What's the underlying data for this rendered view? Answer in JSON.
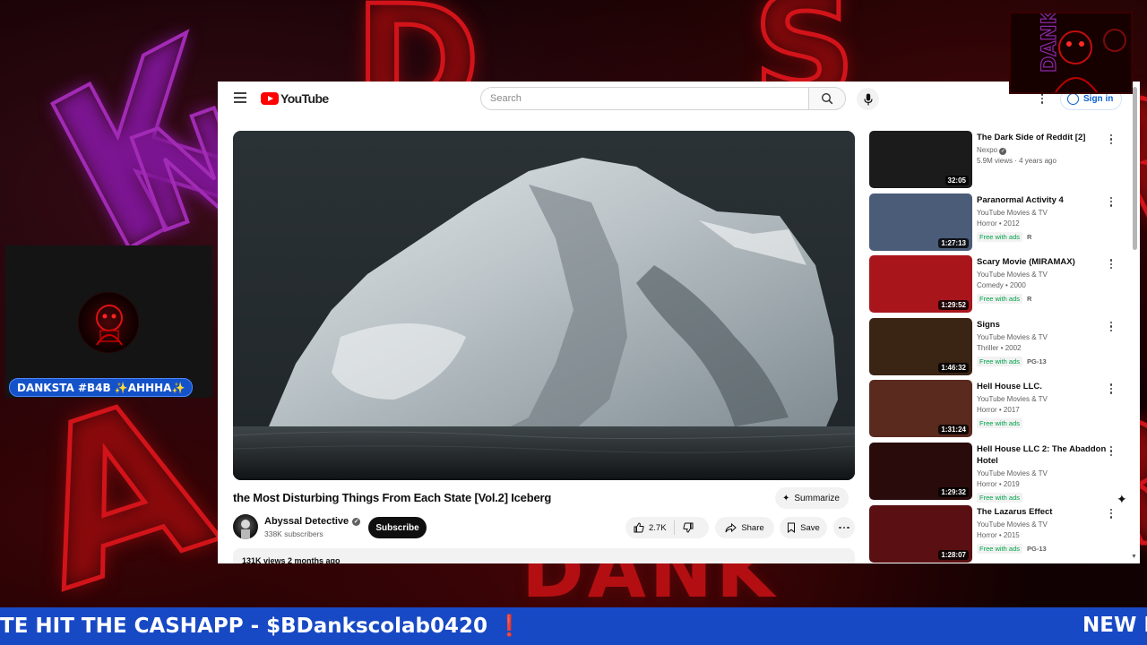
{
  "youtube": {
    "logo_text": "YouTube",
    "search_placeholder": "Search",
    "signin_label": "Sign in",
    "video": {
      "title": "the Most Disturbing Things From Each State [Vol.2] Iceberg",
      "summarize_label": "Summarize",
      "channel_name": "Abyssal Detective",
      "subscribers": "338K subscribers",
      "subscribe_label": "Subscribe",
      "likes": "2.7K",
      "share_label": "Share",
      "save_label": "Save",
      "views_date": "131K views  2 months ago"
    },
    "recommendations": [
      {
        "title": "The Dark Side of Reddit [2]",
        "channel": "Nexpo",
        "verified": true,
        "meta": "5.9M views · 4 years ago",
        "duration": "32:05",
        "free": "",
        "rating": "",
        "thumb_color": "#1b1b1b"
      },
      {
        "title": "Paranormal Activity 4",
        "channel": "YouTube Movies & TV",
        "verified": false,
        "meta": "Horror • 2012",
        "duration": "1:27:13",
        "free": "Free with ads",
        "rating": "R",
        "thumb_color": "#4a5c78"
      },
      {
        "title": "Scary Movie (MIRAMAX)",
        "channel": "YouTube Movies & TV",
        "verified": false,
        "meta": "Comedy • 2000",
        "duration": "1:29:52",
        "free": "Free with ads",
        "rating": "R",
        "thumb_color": "#a8161b"
      },
      {
        "title": "Signs",
        "channel": "YouTube Movies & TV",
        "verified": false,
        "meta": "Thriller • 2002",
        "duration": "1:46:32",
        "free": "Free with ads",
        "rating": "PG-13",
        "thumb_color": "#3a2414"
      },
      {
        "title": "Hell House LLC.",
        "channel": "YouTube Movies & TV",
        "verified": false,
        "meta": "Horror • 2017",
        "duration": "1:31:24",
        "free": "Free with ads",
        "rating": "",
        "thumb_color": "#5a2a1e"
      },
      {
        "title": "Hell House LLC 2: The Abaddon Hotel",
        "channel": "YouTube Movies & TV",
        "verified": false,
        "meta": "Horror • 2019",
        "duration": "1:29:32",
        "free": "Free with ads",
        "rating": "",
        "thumb_color": "#2a0b0c"
      },
      {
        "title": "The Lazarus Effect",
        "channel": "YouTube Movies & TV",
        "verified": false,
        "meta": "Horror • 2015",
        "duration": "1:28:07",
        "free": "Free with ads",
        "rating": "PG-13",
        "thumb_color": "#5a1012"
      }
    ]
  },
  "stream": {
    "cam_name": "DANKSTA #B4B ✨AHHHA✨",
    "ticker_text": "TE HIT THE CASHAPP - $BDankscolab0420",
    "ticker_mark": "❗",
    "ticker_next": "NEW D",
    "background_word": "DANK"
  },
  "colors": {
    "youtube_red": "#ff0000",
    "link_blue": "#065fd4",
    "ticker_blue": "#1849c5",
    "free_green": "#00a34a"
  }
}
